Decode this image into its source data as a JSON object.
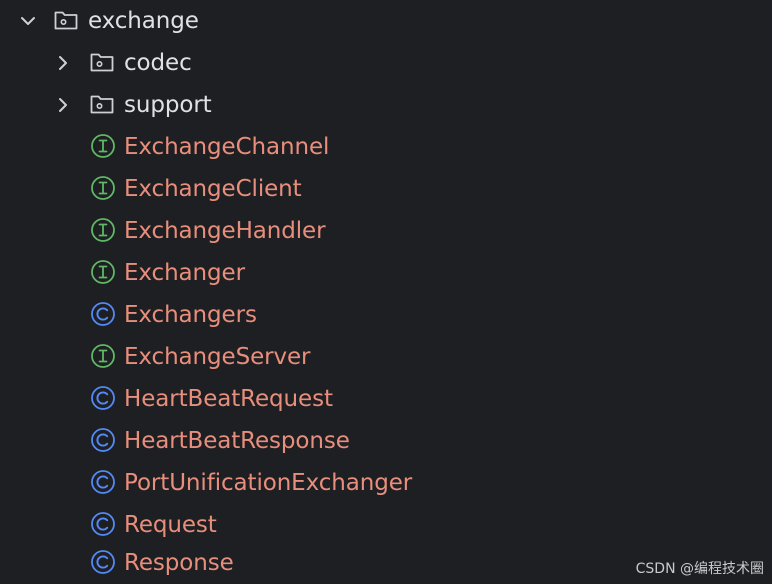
{
  "tree": {
    "root": {
      "label": "exchange",
      "expanded": true,
      "icon": "package-folder-icon"
    },
    "folders": [
      {
        "label": "codec",
        "expanded": false,
        "icon": "package-folder-icon"
      },
      {
        "label": "support",
        "expanded": false,
        "icon": "package-folder-icon"
      }
    ],
    "items": [
      {
        "label": "ExchangeChannel",
        "kind": "interface",
        "icon": "interface-icon"
      },
      {
        "label": "ExchangeClient",
        "kind": "interface",
        "icon": "interface-icon"
      },
      {
        "label": "ExchangeHandler",
        "kind": "interface",
        "icon": "interface-icon"
      },
      {
        "label": "Exchanger",
        "kind": "interface",
        "icon": "interface-icon"
      },
      {
        "label": "Exchangers",
        "kind": "class",
        "icon": "class-icon"
      },
      {
        "label": "ExchangeServer",
        "kind": "interface",
        "icon": "interface-icon"
      },
      {
        "label": "HeartBeatRequest",
        "kind": "class",
        "icon": "class-icon"
      },
      {
        "label": "HeartBeatResponse",
        "kind": "class",
        "icon": "class-icon"
      },
      {
        "label": "PortUnificationExchanger",
        "kind": "class",
        "icon": "class-icon"
      },
      {
        "label": "Request",
        "kind": "class",
        "icon": "class-icon"
      },
      {
        "label": "Response",
        "kind": "class",
        "icon": "class-icon"
      }
    ]
  },
  "colors": {
    "background": "#1e1f22",
    "folder_text": "#dfe1e5",
    "class_text": "#e88e7c",
    "interface_icon": "#5fb865",
    "class_icon": "#548af7"
  },
  "watermark": "CSDN @编程技术圈"
}
